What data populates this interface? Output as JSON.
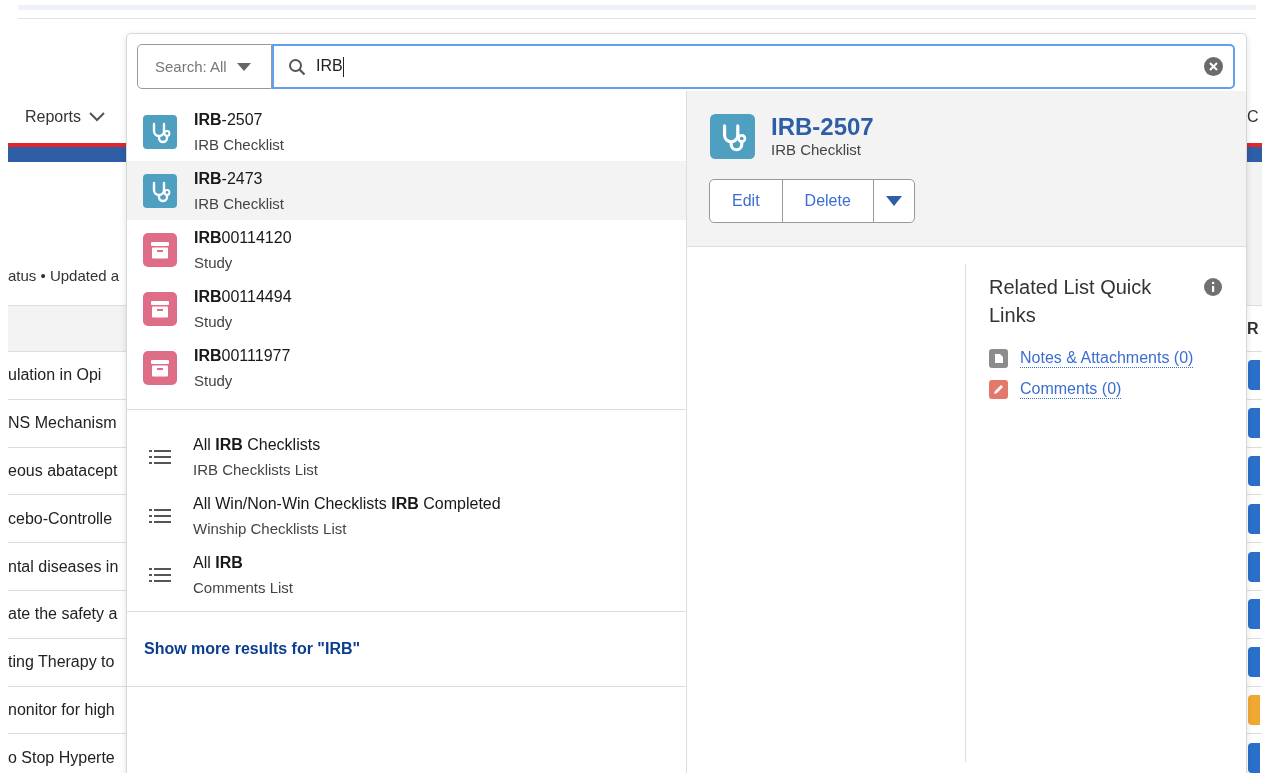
{
  "background": {
    "nav_item": "Reports",
    "subtitle": "atus • Updated a",
    "rows": [
      "ulation in Opi",
      "NS Mechanism",
      "eous abatacept",
      "cebo-Controlle",
      "ntal diseases in",
      "ate the safety a",
      "ting Therapy to",
      "nonitor for high",
      "o Stop Hyperte"
    ],
    "edge_texts": [
      "C",
      "R"
    ],
    "edge_badges": [
      {
        "color": "#2a6fc9"
      },
      {
        "color": "#2a6fc9"
      },
      {
        "color": "#2a6fc9"
      },
      {
        "color": "#2a6fc9"
      },
      {
        "color": "#2a6fc9"
      },
      {
        "color": "#2a6fc9"
      },
      {
        "color": "#2a6fc9"
      },
      {
        "color": "#f0a832"
      },
      {
        "color": "#2a6fc9"
      }
    ]
  },
  "search": {
    "scope": "Search: All",
    "value": "IRB"
  },
  "results": [
    {
      "title": "**IRB**-2507",
      "subtitle": "IRB Checklist",
      "kind": "checklist",
      "selected": false
    },
    {
      "title": "**IRB**-2473",
      "subtitle": "IRB Checklist",
      "kind": "checklist",
      "selected": true
    },
    {
      "title": "**IRB**00114120",
      "subtitle": "Study",
      "kind": "study",
      "selected": false
    },
    {
      "title": "**IRB**00114494",
      "subtitle": "Study",
      "kind": "study",
      "selected": false
    },
    {
      "title": "**IRB**00111977",
      "subtitle": "Study",
      "kind": "study",
      "selected": false
    }
  ],
  "list_views": [
    {
      "title": "All **IRB** Checklists",
      "subtitle": "IRB Checklists List"
    },
    {
      "title": "All Win/Non-Win Checklists **IRB** Completed",
      "subtitle": "Winship Checklists List"
    },
    {
      "title": "All **IRB**",
      "subtitle": "Comments List"
    }
  ],
  "show_more": "Show more results for \"IRB\"",
  "preview": {
    "title": "IRB-2507",
    "subtitle": "IRB Checklist",
    "kind": "checklist",
    "actions": [
      "Edit",
      "Delete"
    ],
    "quick_links": {
      "title": "Related List Quick Links",
      "links": [
        {
          "label": "Notes & Attachments (0)",
          "kind": "notes"
        },
        {
          "label": "Comments (0)",
          "kind": "comments"
        }
      ]
    }
  }
}
